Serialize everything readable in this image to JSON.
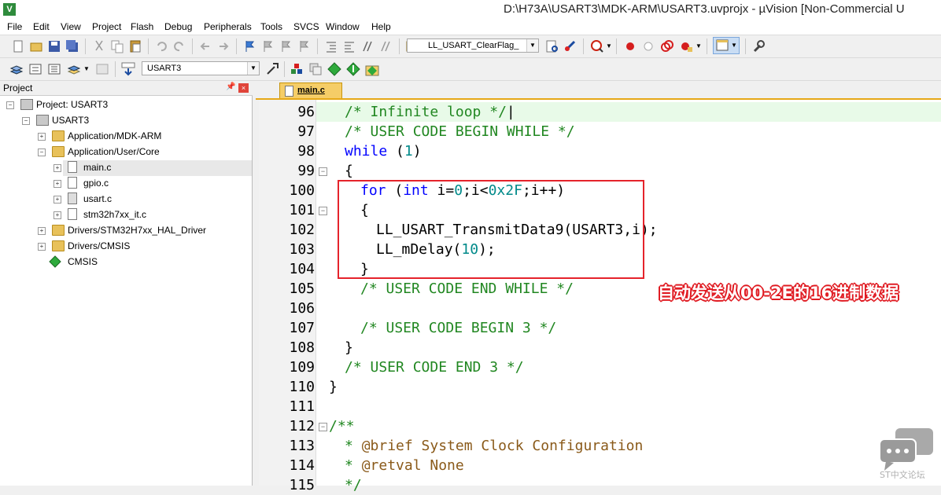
{
  "window": {
    "title": "D:\\H73A\\USART3\\MDK-ARM\\USART3.uvprojx - µVision  [Non-Commercial U"
  },
  "menu": [
    "File",
    "Edit",
    "View",
    "Project",
    "Flash",
    "Debug",
    "Peripherals",
    "Tools",
    "SVCS",
    "Window",
    "Help"
  ],
  "toolbar": {
    "find_combo": "LL_USART_ClearFlag_",
    "target_combo": "USART3"
  },
  "project_panel": {
    "title": "Project",
    "pin": "ᵖ",
    "close": "×",
    "tree": [
      {
        "label": "Project: USART3"
      },
      {
        "label": "USART3"
      },
      {
        "label": "Application/MDK-ARM"
      },
      {
        "label": "Application/User/Core"
      },
      {
        "label": "main.c"
      },
      {
        "label": "gpio.c"
      },
      {
        "label": "usart.c"
      },
      {
        "label": "stm32h7xx_it.c"
      },
      {
        "label": "Drivers/STM32H7xx_HAL_Driver"
      },
      {
        "label": "Drivers/CMSIS"
      },
      {
        "label": "CMSIS"
      }
    ]
  },
  "editor": {
    "active_tab": "main.c",
    "line_numbers": [
      "96",
      "97",
      "98",
      "99",
      "100",
      "101",
      "102",
      "103",
      "104",
      "105",
      "106",
      "107",
      "108",
      "109",
      "110",
      "111",
      "112",
      "113",
      "114",
      "115"
    ],
    "code": {
      "l96": "/* Infinite loop */",
      "l97": "/* USER CODE BEGIN WHILE */",
      "l98_kw": "while",
      "l98_a": " (",
      "l98_n": "1",
      "l98_b": ")",
      "l99": "{",
      "l100_kw1": "for",
      "l100_a": " (",
      "l100_kw2": "int",
      "l100_b": " i=",
      "l100_n1": "0",
      "l100_c": ";i<",
      "l100_n2": "0x2F",
      "l100_d": ";i++)",
      "l101": "{",
      "l102": "LL_USART_TransmitData9(USART3,i);",
      "l103_a": "LL_mDelay(",
      "l103_n": "10",
      "l103_b": ");",
      "l104": "}",
      "l105": "/* USER CODE END WHILE */",
      "l107": "/* USER CODE BEGIN 3 */",
      "l108": "}",
      "l109": "/* USER CODE END 3 */",
      "l110": "}",
      "l112": "/**",
      "l113_a": "* ",
      "l113_b": "@brief System Clock Configuration",
      "l114_a": "* ",
      "l114_b": "@retval None",
      "l115": "*/"
    },
    "fold_minus": "−"
  },
  "annotation": "自动发送从00-2E的16进制数据",
  "watermark": "ST中文论坛",
  "colors": {
    "comment": "#218721",
    "keyword": "#0000ff",
    "number": "#008a8a",
    "annotation_red": "#e01b22"
  }
}
